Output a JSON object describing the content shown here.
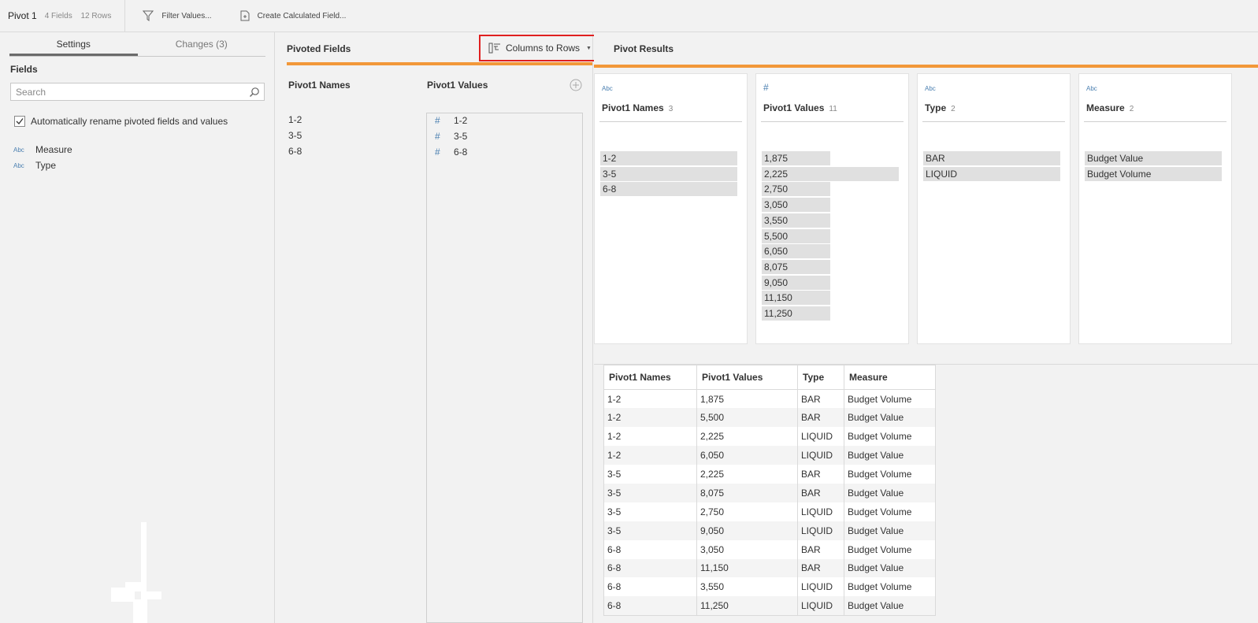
{
  "toolbar": {
    "title": "Pivot 1",
    "fields_count": "4 Fields",
    "rows_count": "12 Rows",
    "filter_label": "Filter Values...",
    "calc_label": "Create Calculated Field..."
  },
  "left": {
    "tabs": [
      "Settings",
      "Changes (3)"
    ],
    "active_tab": "Settings",
    "fields_heading": "Fields",
    "search_placeholder": "Search",
    "auto_rename_label": "Automatically rename pivoted fields and values",
    "auto_rename_checked": true,
    "fields": [
      {
        "type": "Abc",
        "name": "Measure"
      },
      {
        "type": "Abc",
        "name": "Type"
      }
    ]
  },
  "mid": {
    "title": "Pivoted Fields",
    "pivot_type": "Columns to Rows",
    "names_header": "Pivot1 Names",
    "values_header": "Pivot1 Values",
    "names": [
      "1-2",
      "3-5",
      "6-8"
    ],
    "values": [
      "1-2",
      "3-5",
      "6-8"
    ]
  },
  "right": {
    "title": "Pivot Results",
    "profile_cards": [
      {
        "type": "Abc",
        "name": "Pivot1 Names",
        "count": "3",
        "values": [
          "1-2",
          "3-5",
          "6-8"
        ],
        "fractions": [
          1,
          1,
          1
        ]
      },
      {
        "type": "#",
        "name": "Pivot1 Values",
        "count": "11",
        "values": [
          "1,875",
          "2,225",
          "2,750",
          "3,050",
          "3,550",
          "5,500",
          "6,050",
          "8,075",
          "9,050",
          "11,150",
          "11,250"
        ],
        "fractions": [
          0.5,
          1,
          0.5,
          0.5,
          0.5,
          0.5,
          0.5,
          0.5,
          0.5,
          0.5,
          0.5
        ]
      },
      {
        "type": "Abc",
        "name": "Type",
        "count": "2",
        "values": [
          "BAR",
          "LIQUID"
        ],
        "fractions": [
          1,
          1
        ]
      },
      {
        "type": "Abc",
        "name": "Measure",
        "count": "2",
        "values": [
          "Budget Value",
          "Budget Volume"
        ],
        "fractions": [
          1,
          1
        ]
      }
    ],
    "table": {
      "headers": [
        "Pivot1 Names",
        "Pivot1 Values",
        "Type",
        "Measure"
      ],
      "rows": [
        [
          "1-2",
          "1,875",
          "BAR",
          "Budget Volume"
        ],
        [
          "1-2",
          "5,500",
          "BAR",
          "Budget Value"
        ],
        [
          "1-2",
          "2,225",
          "LIQUID",
          "Budget Volume"
        ],
        [
          "1-2",
          "6,050",
          "LIQUID",
          "Budget Value"
        ],
        [
          "3-5",
          "2,225",
          "BAR",
          "Budget Volume"
        ],
        [
          "3-5",
          "8,075",
          "BAR",
          "Budget Value"
        ],
        [
          "3-5",
          "2,750",
          "LIQUID",
          "Budget Volume"
        ],
        [
          "3-5",
          "9,050",
          "LIQUID",
          "Budget Value"
        ],
        [
          "6-8",
          "3,050",
          "BAR",
          "Budget Volume"
        ],
        [
          "6-8",
          "11,150",
          "BAR",
          "Budget Value"
        ],
        [
          "6-8",
          "3,550",
          "LIQUID",
          "Budget Volume"
        ],
        [
          "6-8",
          "11,250",
          "LIQUID",
          "Budget Value"
        ]
      ]
    }
  },
  "colors": {
    "accent_orange": "#f29839",
    "highlight_red": "#e02020",
    "type_blue": "#4a7fb0"
  }
}
